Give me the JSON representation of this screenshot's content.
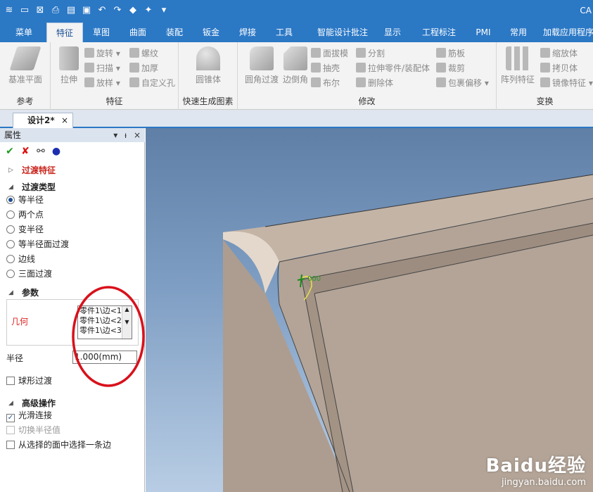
{
  "app": {
    "title": "CA"
  },
  "qat": {
    "icons": [
      "app-logo-icon",
      "new-icon",
      "close-doc-icon",
      "print-icon",
      "open-icon",
      "save-icon",
      "undo-icon",
      "redo-icon",
      "render-icon",
      "sparkle-icon",
      "dropdown-icon"
    ]
  },
  "menu": {
    "tabs": [
      "菜单",
      "特征",
      "草图",
      "曲面",
      "装配",
      "钣金",
      "焊接",
      "工具",
      "智能设计批注",
      "显示",
      "工程标注",
      "PMI",
      "常用",
      "加载应用程序"
    ],
    "active": "特征"
  },
  "ribbon": {
    "groups": {
      "reference": {
        "label": "参考",
        "base_plane": "基准平面"
      },
      "feature": {
        "label": "特征",
        "extrude": "拉伸",
        "revolve": "旋转",
        "sweep": "扫描",
        "loft": "放样",
        "thread": "螺纹",
        "thicken": "加厚",
        "custom_hole": "自定义孔"
      },
      "quick": {
        "label": "快速生成图素",
        "cone": "圆锥体"
      },
      "modify": {
        "label": "修改",
        "fillet": "圆角过渡",
        "chamfer": "边倒角",
        "draft": "面拔模",
        "shell": "抽壳",
        "boolean": "布尔",
        "split": "分割",
        "extrude_part": "拉伸零件/装配体",
        "delete_body": "删除体",
        "rib": "筋板",
        "trim": "裁剪",
        "wrap_offset": "包裹偏移"
      },
      "transform": {
        "label": "变换",
        "pattern": "阵列特征",
        "scale": "缩放体",
        "copy": "拷贝体",
        "mirror": "镜像特征"
      }
    }
  },
  "doc": {
    "tab_label": "设计2*",
    "close": "×"
  },
  "panel": {
    "title": "属性",
    "header_ctrls": [
      "▾",
      "ᵼ",
      "×"
    ],
    "section_fillet": "过渡特征",
    "section_type": "过渡类型",
    "type_options": [
      "等半径",
      "两个点",
      "变半径",
      "等半径面过渡",
      "边线",
      "三面过渡"
    ],
    "selected_type": "等半径",
    "section_params": "参数",
    "geometry_label": "几何",
    "geometry_items": [
      "零件1\\边<1",
      "零件1\\边<2",
      "零件1\\边<3"
    ],
    "radius_label": "半径",
    "radius_value": "1.000(mm)",
    "sphere_fillet": "球形过渡",
    "sphere_checked": false,
    "section_advanced": "高级操作",
    "smooth_connect": "光滑连接",
    "smooth_checked": true,
    "switch_radius": "切换半径值",
    "select_from_face": "从选择的面中选择一条边",
    "select_checked": false
  },
  "viewport": {
    "annotation": "000",
    "watermark_brand": "Baidu经验",
    "watermark_url": "jingyan.baidu.com"
  },
  "colors": {
    "title_bar": "#2b78c5",
    "model_face": "#b3a497",
    "highlight_circle": "#d8111b"
  }
}
